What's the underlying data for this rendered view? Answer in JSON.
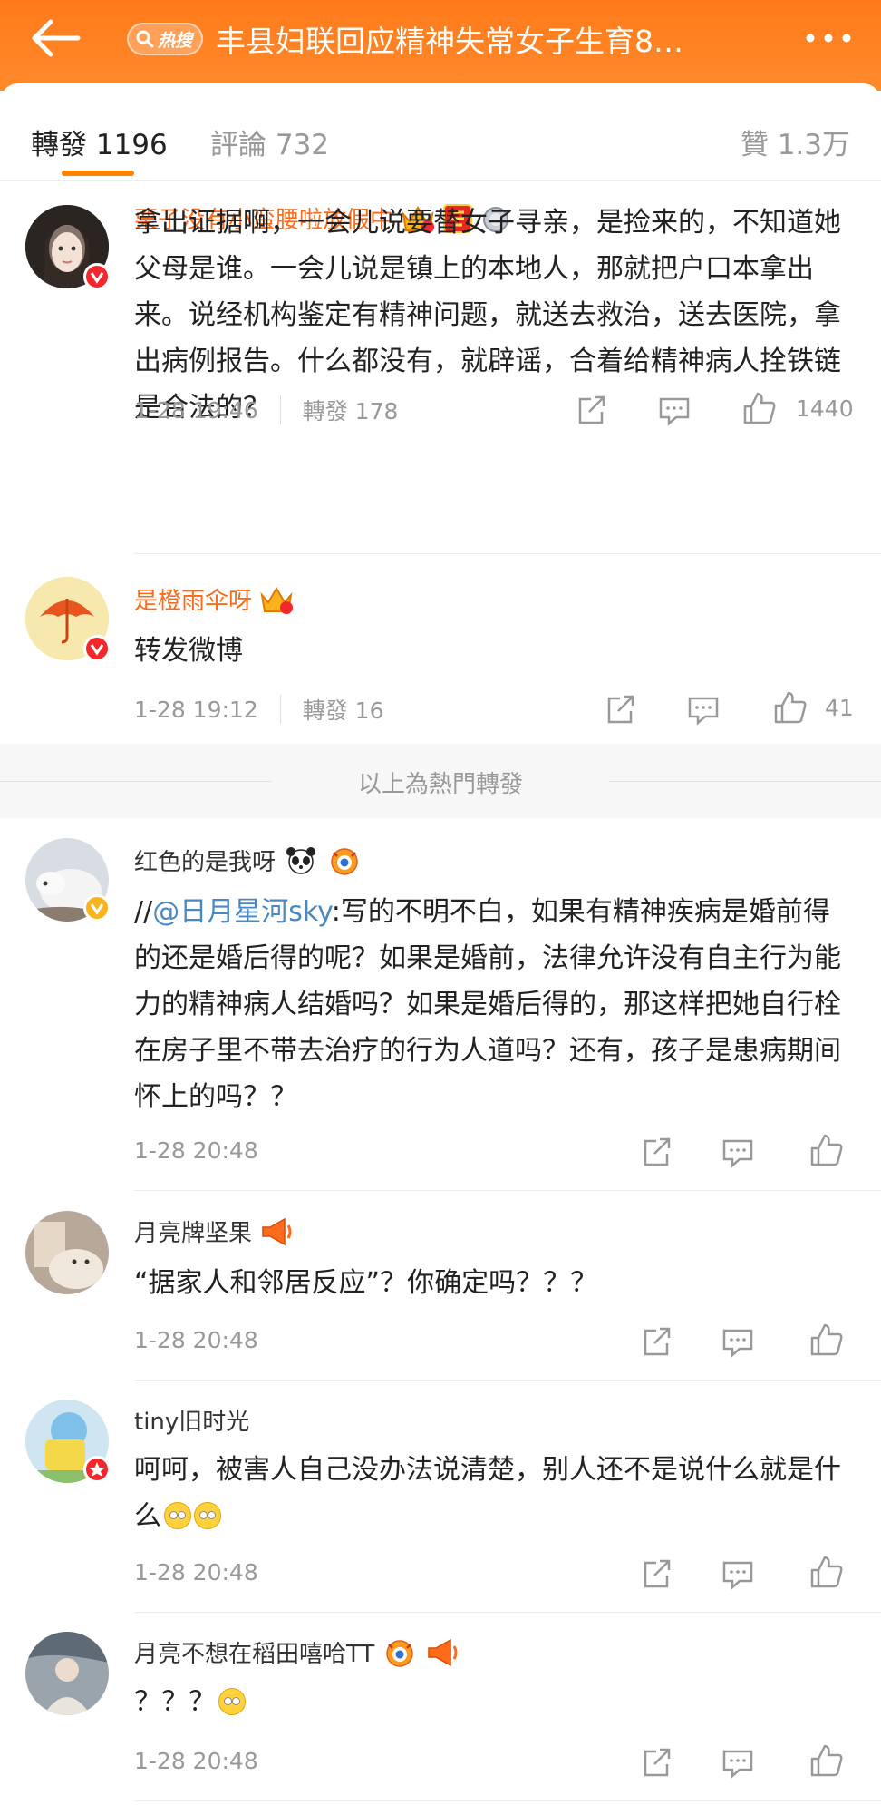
{
  "header": {
    "hot_label": "热搜",
    "title": "丰县妇联回应精神失常女子生育8…"
  },
  "tabs": {
    "repost": "轉發 1196",
    "comment": "評論 732",
    "like": "贊 1.3万"
  },
  "hot_section_label": "以上為熱門轉發",
  "colors": {
    "brand": "#ff8200",
    "vip_name": "#f86c1b",
    "mention": "#4a88c4",
    "muted": "#999999"
  },
  "posts": [
    {
      "name": "栗子没有小蛮腰啦放假中",
      "text": "拿出证据啊，一会儿说要替女子寻亲，是捡来的，不知道她父母是谁。一会儿说是镇上的本地人，那就把户口本拿出来。说经机构鉴定有精神问题，就送去救治，送去医院，拿出病例报告。什么都没有，就辟谣，合着给精神病人拴铁链是合法的？",
      "time": "1-28 19:46",
      "reposts": "轉發 178",
      "likes": "1440",
      "badges": [
        "vip-crown-icon",
        "fu-badge-icon",
        "medal-icon"
      ]
    },
    {
      "name": "是橙雨伞呀",
      "text": "转发微博",
      "time": "1-28 19:12",
      "reposts": "轉發 16",
      "likes": "41",
      "badges": [
        "vip-crown-icon"
      ]
    },
    {
      "name": "红色的是我呀",
      "text_prefix": "//",
      "mention": "@日月星河sky",
      "text": ":写的不明不白，如果有精神疾病是婚前得的还是婚后得的呢？如果是婚前，法律允许没有自主行为能力的精神病人结婚吗？如果是婚后得的，那这样把她自行栓在房子里不带去治疗的行为人道吗？还有，孩子是患病期间怀上的吗？？",
      "time": "1-28 20:48",
      "badges": [
        "panda-icon",
        "tiger-icon"
      ]
    },
    {
      "name": "月亮牌坚果",
      "text": "“据家人和邻居反应”？你确定吗？？？",
      "time": "1-28 20:48",
      "badges": [
        "megaphone-icon"
      ]
    },
    {
      "name": "tiny旧时光",
      "text": "呵呵，被害人自己没办法说清楚，别人还不是说什么就是什么",
      "time": "1-28 20:48",
      "badges": []
    },
    {
      "name": "月亮不想在稻田嘻哈TT",
      "text": "？？？",
      "time": "1-28 20:48",
      "badges": [
        "tiger-icon",
        "megaphone-icon"
      ]
    }
  ]
}
